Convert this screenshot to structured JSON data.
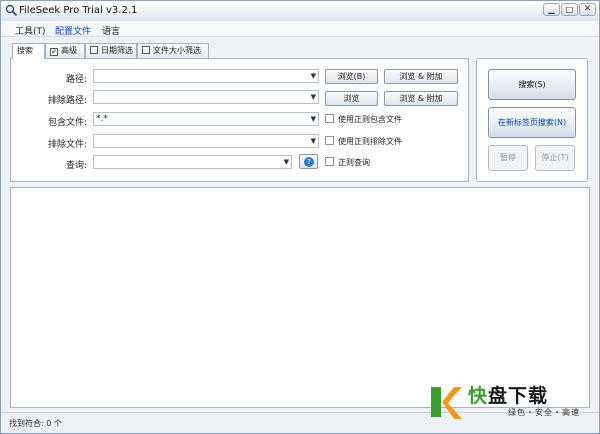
{
  "window": {
    "title": "FileSeek Pro Trial v3.2.1"
  },
  "menu": {
    "items": [
      "工具(T)",
      "配置文件",
      "语言"
    ]
  },
  "tabs": [
    "搜索",
    "高级",
    "日期筛选",
    "文件大小筛选"
  ],
  "form": {
    "path_label": "路径:",
    "path_value": "",
    "exclude_path_label": "排除路径:",
    "exclude_path_value": "",
    "include_files_label": "包含文件:",
    "include_files_value": "*.*",
    "exclude_files_label": "排除文件:",
    "exclude_files_value": "",
    "query_label": "查询:",
    "query_value": "",
    "browse_label": "浏览(B)",
    "browse_append_label": "浏览 & 附加",
    "browse2_label": "浏览",
    "browse2_append_label": "浏览 & 附加",
    "regex_include_label": "使用正则包含文件",
    "regex_exclude_label": "使用正则排除文件",
    "regex_query_label": "正则查询"
  },
  "actions": {
    "search_label": "搜索(S)",
    "new_tab_search_label": "在新标签页搜索(N)",
    "pause_label": "暂停",
    "stop_label": "停止(T)"
  },
  "status": {
    "text": "找到符合: 0 个"
  },
  "watermark": {
    "brand_char": "快",
    "brand_rest": "盘下载",
    "tagline": "绿色・安全・高速"
  },
  "colors": {
    "accent": "#0a3fc0",
    "watermark_green": "#3aa02c",
    "watermark_orange": "#f39a1e"
  },
  "icons": {
    "title": "magnifier-icon",
    "help": "help-icon",
    "check": "green-check-icon"
  }
}
